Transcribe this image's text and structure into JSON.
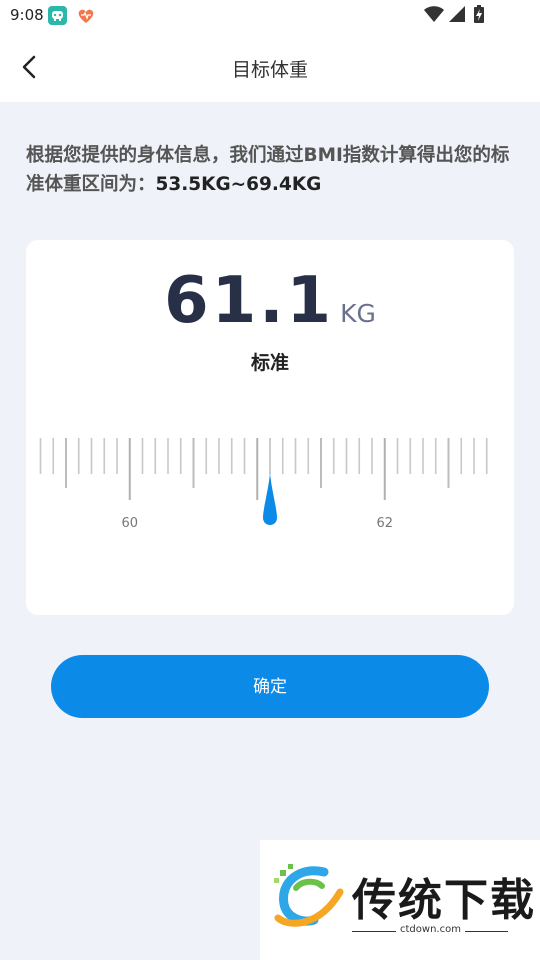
{
  "status_bar": {
    "time": "9:08",
    "icons": [
      "app-icon",
      "heart-app-icon",
      "wifi-icon",
      "signal-icon",
      "battery-charging-icon"
    ]
  },
  "header": {
    "title": "目标体重",
    "back_icon": "chevron-left-icon"
  },
  "description": {
    "text": "根据您提供的身体信息，我们通过BMI指数计算得出您的标准体重区间为：",
    "range": "53.5KG~69.4KG"
  },
  "scale": {
    "value": "61.1",
    "unit": "KG",
    "status": "标准",
    "ruler": {
      "selected_value": 61.1,
      "labels": [
        "60",
        "62"
      ],
      "label_values": [
        60,
        62
      ],
      "min_visible": 59.0,
      "max_visible": 62.8,
      "step": 0.1
    },
    "indicator_color": "#0b8ae8"
  },
  "confirm_button": {
    "label": "确定",
    "color": "#0b8ae8"
  },
  "watermark": {
    "title": "传统下载",
    "subtitle": "ctdown.com"
  }
}
